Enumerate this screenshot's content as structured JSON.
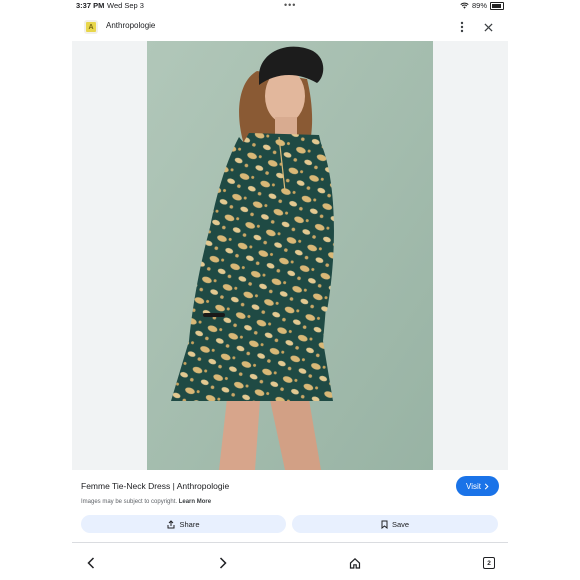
{
  "status_bar": {
    "time": "3:37 PM",
    "date": "Wed Sep 3",
    "battery": "89%",
    "battery_level": 0.89,
    "wifi_icon": "wifi-icon",
    "battery_icon": "battery-icon"
  },
  "header": {
    "logo_letter": "A",
    "site_name": "Anthropologie",
    "menu_icon": "more-vert-icon",
    "close_icon": "close-icon"
  },
  "product": {
    "title": "Femme Tie-Neck Dress | Anthropologie",
    "visit_label": "Visit",
    "copyright_text": "Images may be subject to copyright.",
    "learn_more": "Learn More",
    "share_label": "Share",
    "save_label": "Save"
  },
  "nav": {
    "tab_count": "2"
  },
  "colors": {
    "accent": "#1a73e8",
    "action_bg": "#e8f0fe",
    "photo_bg": "#a9c1b2",
    "dress": "#1f4a44",
    "pattern": "#d9b877"
  }
}
